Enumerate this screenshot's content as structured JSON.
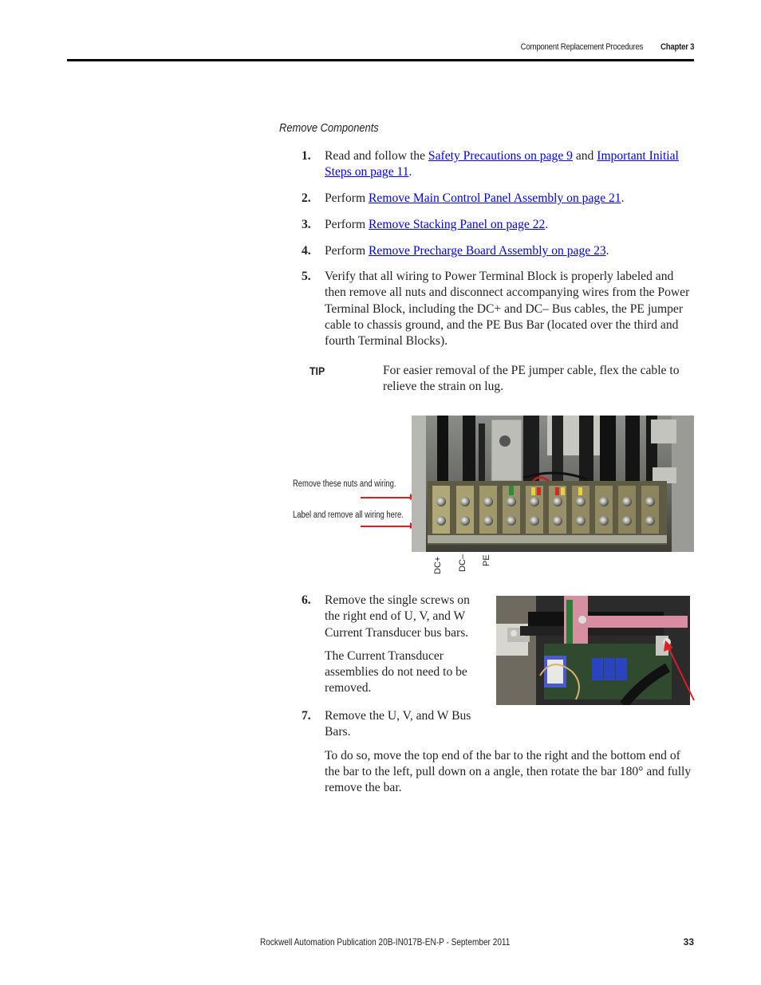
{
  "header": {
    "section": "Component Replacement Procedures",
    "chapter": "Chapter 3"
  },
  "section_title": "Remove Components",
  "steps": [
    {
      "num": "1.",
      "parts": [
        {
          "text": "Read and follow the "
        },
        {
          "link": "Safety Precautions on page 9"
        },
        {
          "text": " and "
        },
        {
          "link": "Important Initial Steps on page 11"
        },
        {
          "text": "."
        }
      ]
    },
    {
      "num": "2.",
      "parts": [
        {
          "text": "Perform "
        },
        {
          "link": "Remove Main Control Panel Assembly on page 21"
        },
        {
          "text": "."
        }
      ]
    },
    {
      "num": "3.",
      "parts": [
        {
          "text": "Perform "
        },
        {
          "link": "Remove Stacking Panel on page 22"
        },
        {
          "text": "."
        }
      ]
    },
    {
      "num": "4.",
      "parts": [
        {
          "text": "Perform "
        },
        {
          "link": "Remove Precharge Board Assembly on page 23"
        },
        {
          "text": "."
        }
      ]
    },
    {
      "num": "5.",
      "text": "Verify that all wiring to Power Terminal Block is properly labeled and then remove all nuts and disconnect accompanying wires from the Power Terminal Block, including the DC+ and DC– Bus cables, the PE jumper cable to chassis ground, and the PE Bus Bar (located over the third and fourth Terminal Blocks)."
    },
    {
      "num": "6.",
      "text": "Remove the single screws on the right end of U, V, and W Current Transducer bus bars.",
      "note": "The Current Transducer assemblies do not need to be removed."
    },
    {
      "num": "7.",
      "text": "Remove the U, V, and W Bus Bars.",
      "note": "To do so, move the top end of the bar to the right and the bottom end of the bar to the left, pull down on a angle, then rotate the bar 180° and fully remove the bar."
    }
  ],
  "tip": {
    "label": "TIP",
    "text": "For easier removal of the PE jumper cable, flex the cable to relieve the strain on lug."
  },
  "figure1": {
    "description": "Power terminal block photo",
    "callouts": [
      "Remove these nuts and wiring.",
      "Label and remove all wiring here."
    ],
    "terminal_labels": [
      "DC+",
      "DC–",
      "PE"
    ]
  },
  "figure2": {
    "description": "Current transducer bus bar photo"
  },
  "colors": {
    "link": "#0000ee",
    "callout_arrow": "#e31b23"
  },
  "footer": {
    "publication": "Rockwell Automation Publication 20B-IN017B-EN-P - September 2011",
    "page_number": "33"
  }
}
